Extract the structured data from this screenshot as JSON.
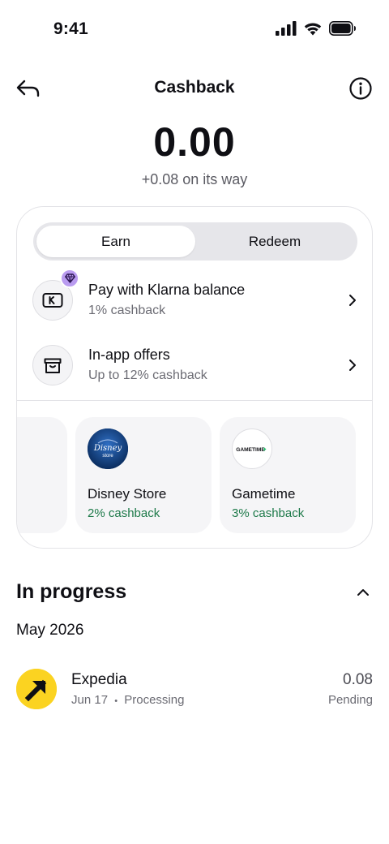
{
  "status_bar": {
    "time": "9:41"
  },
  "nav": {
    "title": "Cashback"
  },
  "balance": {
    "amount": "0.00",
    "pending_text": "+0.08 on its way"
  },
  "tabs": [
    {
      "label": "Earn",
      "active": true
    },
    {
      "label": "Redeem",
      "active": false
    }
  ],
  "earn_options": [
    {
      "title": "Pay with Klarna balance",
      "subtitle": "1% cashback",
      "icon": "klarna-card-icon",
      "badge_icon": "diamond-icon"
    },
    {
      "title": "In-app offers",
      "subtitle": "Up to 12% cashback",
      "icon": "gift-box-icon"
    }
  ],
  "merchants": [
    {
      "name": "Disney Store",
      "cashback": "2% cashback",
      "logo_text": "Disney store",
      "logo_color": "#0e3a78"
    },
    {
      "name": "Gametime",
      "cashback": "3% cashback",
      "logo_text": "GAMETIME",
      "logo_color": "#ffffff"
    }
  ],
  "in_progress": {
    "title": "In progress",
    "month": "May 2026",
    "transactions": [
      {
        "merchant": "Expedia",
        "date": "Jun 17",
        "separator": "•",
        "state": "Processing",
        "amount": "0.08",
        "status": "Pending",
        "logo_color": "#fbd321"
      }
    ]
  },
  "colors": {
    "accent_green": "#1e7a4a",
    "badge_purple": "#b99bf0",
    "text_primary": "#0f0f14"
  }
}
